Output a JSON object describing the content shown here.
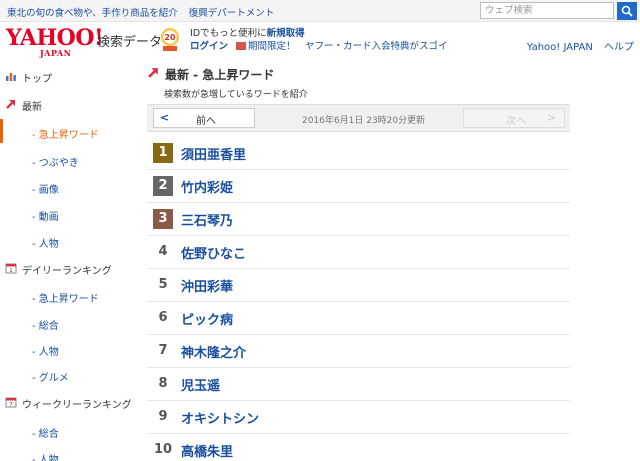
{
  "topbar": {
    "links": [
      "東北の旬の食べ物や、手作り商品を紹介",
      "復興デパートメント"
    ],
    "search_placeholder": "ウェブ検索"
  },
  "header": {
    "logo": "YAHOO!",
    "logo_sub": "JAPAN",
    "service_name": "検索データ",
    "badge_text": "20",
    "promo_line1_prefix": "IDでもっと便利に",
    "promo_line1_link": "新規取得",
    "promo_login": "ログイン",
    "promo_campaign": "期間限定！　ヤフー・カード入会特典がスゴイ",
    "right_links": [
      "Yahoo! JAPAN",
      "ヘルプ"
    ]
  },
  "sidebar": {
    "items": [
      {
        "label": "トップ",
        "kind": "head",
        "icon": "chart-icon"
      },
      {
        "label": "最新",
        "kind": "head",
        "icon": "trend-arrow-icon"
      },
      {
        "label": "- 急上昇ワード",
        "kind": "active"
      },
      {
        "label": "- つぶやき",
        "kind": "sub"
      },
      {
        "label": "- 画像",
        "kind": "sub"
      },
      {
        "label": "- 動画",
        "kind": "sub"
      },
      {
        "label": "- 人物",
        "kind": "sub"
      },
      {
        "label": "デイリーランキング",
        "kind": "head",
        "icon": "calendar-icon"
      },
      {
        "label": "- 急上昇ワード",
        "kind": "sub"
      },
      {
        "label": "- 総合",
        "kind": "sub"
      },
      {
        "label": "- 人物",
        "kind": "sub"
      },
      {
        "label": "- グルメ",
        "kind": "sub"
      },
      {
        "label": "ウィークリーランキング",
        "kind": "head",
        "icon": "calendar-icon"
      },
      {
        "label": "- 総合",
        "kind": "sub"
      },
      {
        "label": "- 人物",
        "kind": "sub"
      }
    ]
  },
  "main": {
    "title": "最新 - 急上昇ワード",
    "description": "検索数が急増しているワードを紹介",
    "pager": {
      "prev_label": "前へ",
      "prev_chevron": "<",
      "next_label": "次へ",
      "next_chevron": ">",
      "updated": "2016年6月1日 23時20分更新"
    },
    "ranking": [
      {
        "rank": "1",
        "name": "須田亜香里"
      },
      {
        "rank": "2",
        "name": "竹内彩姫"
      },
      {
        "rank": "3",
        "name": "三石琴乃"
      },
      {
        "rank": "4",
        "name": "佐野ひなこ"
      },
      {
        "rank": "5",
        "name": "沖田彩華"
      },
      {
        "rank": "6",
        "name": "ピック病"
      },
      {
        "rank": "7",
        "name": "神木隆之介"
      },
      {
        "rank": "8",
        "name": "児玉遥"
      },
      {
        "rank": "9",
        "name": "オキシトシン"
      },
      {
        "rank": "10",
        "name": "高橋朱里"
      }
    ],
    "medal_colors": [
      "#8a6a10",
      "#666666",
      "#8a5a48"
    ]
  },
  "colors": {
    "brand_red": "#e60027",
    "link_blue": "#1a4fa0",
    "active_orange": "#e8620a"
  }
}
